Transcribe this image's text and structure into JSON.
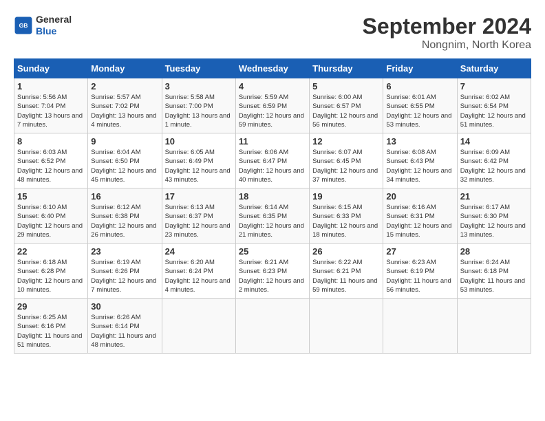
{
  "header": {
    "logo_line1": "General",
    "logo_line2": "Blue",
    "month": "September 2024",
    "location": "Nongnim, North Korea"
  },
  "days_of_week": [
    "Sunday",
    "Monday",
    "Tuesday",
    "Wednesday",
    "Thursday",
    "Friday",
    "Saturday"
  ],
  "weeks": [
    [
      {
        "day": "1",
        "sunrise": "5:56 AM",
        "sunset": "7:04 PM",
        "daylight": "13 hours and 7 minutes."
      },
      {
        "day": "2",
        "sunrise": "5:57 AM",
        "sunset": "7:02 PM",
        "daylight": "13 hours and 4 minutes."
      },
      {
        "day": "3",
        "sunrise": "5:58 AM",
        "sunset": "7:00 PM",
        "daylight": "13 hours and 1 minute."
      },
      {
        "day": "4",
        "sunrise": "5:59 AM",
        "sunset": "6:59 PM",
        "daylight": "12 hours and 59 minutes."
      },
      {
        "day": "5",
        "sunrise": "6:00 AM",
        "sunset": "6:57 PM",
        "daylight": "12 hours and 56 minutes."
      },
      {
        "day": "6",
        "sunrise": "6:01 AM",
        "sunset": "6:55 PM",
        "daylight": "12 hours and 53 minutes."
      },
      {
        "day": "7",
        "sunrise": "6:02 AM",
        "sunset": "6:54 PM",
        "daylight": "12 hours and 51 minutes."
      }
    ],
    [
      {
        "day": "8",
        "sunrise": "6:03 AM",
        "sunset": "6:52 PM",
        "daylight": "12 hours and 48 minutes."
      },
      {
        "day": "9",
        "sunrise": "6:04 AM",
        "sunset": "6:50 PM",
        "daylight": "12 hours and 45 minutes."
      },
      {
        "day": "10",
        "sunrise": "6:05 AM",
        "sunset": "6:49 PM",
        "daylight": "12 hours and 43 minutes."
      },
      {
        "day": "11",
        "sunrise": "6:06 AM",
        "sunset": "6:47 PM",
        "daylight": "12 hours and 40 minutes."
      },
      {
        "day": "12",
        "sunrise": "6:07 AM",
        "sunset": "6:45 PM",
        "daylight": "12 hours and 37 minutes."
      },
      {
        "day": "13",
        "sunrise": "6:08 AM",
        "sunset": "6:43 PM",
        "daylight": "12 hours and 34 minutes."
      },
      {
        "day": "14",
        "sunrise": "6:09 AM",
        "sunset": "6:42 PM",
        "daylight": "12 hours and 32 minutes."
      }
    ],
    [
      {
        "day": "15",
        "sunrise": "6:10 AM",
        "sunset": "6:40 PM",
        "daylight": "12 hours and 29 minutes."
      },
      {
        "day": "16",
        "sunrise": "6:12 AM",
        "sunset": "6:38 PM",
        "daylight": "12 hours and 26 minutes."
      },
      {
        "day": "17",
        "sunrise": "6:13 AM",
        "sunset": "6:37 PM",
        "daylight": "12 hours and 23 minutes."
      },
      {
        "day": "18",
        "sunrise": "6:14 AM",
        "sunset": "6:35 PM",
        "daylight": "12 hours and 21 minutes."
      },
      {
        "day": "19",
        "sunrise": "6:15 AM",
        "sunset": "6:33 PM",
        "daylight": "12 hours and 18 minutes."
      },
      {
        "day": "20",
        "sunrise": "6:16 AM",
        "sunset": "6:31 PM",
        "daylight": "12 hours and 15 minutes."
      },
      {
        "day": "21",
        "sunrise": "6:17 AM",
        "sunset": "6:30 PM",
        "daylight": "12 hours and 13 minutes."
      }
    ],
    [
      {
        "day": "22",
        "sunrise": "6:18 AM",
        "sunset": "6:28 PM",
        "daylight": "12 hours and 10 minutes."
      },
      {
        "day": "23",
        "sunrise": "6:19 AM",
        "sunset": "6:26 PM",
        "daylight": "12 hours and 7 minutes."
      },
      {
        "day": "24",
        "sunrise": "6:20 AM",
        "sunset": "6:24 PM",
        "daylight": "12 hours and 4 minutes."
      },
      {
        "day": "25",
        "sunrise": "6:21 AM",
        "sunset": "6:23 PM",
        "daylight": "12 hours and 2 minutes."
      },
      {
        "day": "26",
        "sunrise": "6:22 AM",
        "sunset": "6:21 PM",
        "daylight": "11 hours and 59 minutes."
      },
      {
        "day": "27",
        "sunrise": "6:23 AM",
        "sunset": "6:19 PM",
        "daylight": "11 hours and 56 minutes."
      },
      {
        "day": "28",
        "sunrise": "6:24 AM",
        "sunset": "6:18 PM",
        "daylight": "11 hours and 53 minutes."
      }
    ],
    [
      {
        "day": "29",
        "sunrise": "6:25 AM",
        "sunset": "6:16 PM",
        "daylight": "11 hours and 51 minutes."
      },
      {
        "day": "30",
        "sunrise": "6:26 AM",
        "sunset": "6:14 PM",
        "daylight": "11 hours and 48 minutes."
      },
      null,
      null,
      null,
      null,
      null
    ]
  ]
}
